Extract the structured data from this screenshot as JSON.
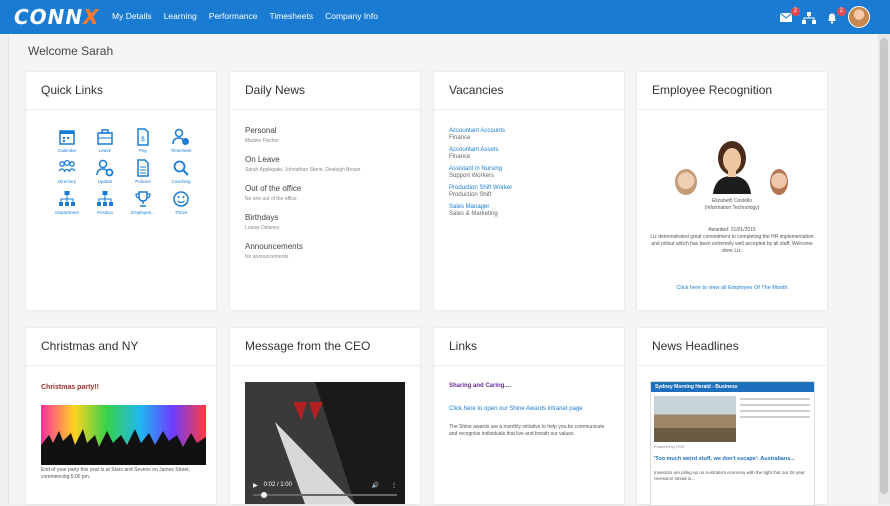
{
  "app": {
    "logo_main": "CONN",
    "logo_x": "X"
  },
  "nav": [
    "My Details",
    "Learning",
    "Performance",
    "Timesheets",
    "Company Info"
  ],
  "header_icons": {
    "notifications": [
      {
        "name": "mail-icon",
        "badge": "2"
      },
      {
        "name": "sitemap-icon",
        "badge": ""
      },
      {
        "name": "bell-icon",
        "badge": "2"
      }
    ]
  },
  "welcome": "Welcome Sarah",
  "cards": {
    "quick_links": {
      "title": "Quick Links",
      "items": [
        {
          "label": "Calendar",
          "icon": "calendar-icon"
        },
        {
          "label": "Leave",
          "icon": "briefcase-icon"
        },
        {
          "label": "Pay",
          "icon": "payslip-icon"
        },
        {
          "label": "Timesheet",
          "icon": "user-clock-icon"
        },
        {
          "label": "Directory",
          "icon": "group-icon"
        },
        {
          "label": "Update",
          "icon": "user-settings-icon"
        },
        {
          "label": "Policies",
          "icon": "document-icon"
        },
        {
          "label": "Coaching",
          "icon": "search-icon"
        },
        {
          "label": "Department",
          "icon": "org-chart-icon"
        },
        {
          "label": "Position",
          "icon": "org-chart-icon"
        },
        {
          "label": "Employee...",
          "icon": "trophy-icon"
        },
        {
          "label": "Thrive",
          "icon": "smiley-icon"
        }
      ]
    },
    "daily_news": {
      "title": "Daily News",
      "sections": [
        {
          "heading": "Personal",
          "body": "Maxine Fischer"
        },
        {
          "heading": "On Leave",
          "body": "Sarah Applegate, Johnathan Stone, Desleigh Brown"
        },
        {
          "heading": "Out of the office",
          "body": "No one out of the office"
        },
        {
          "heading": "Birthdays",
          "body": "Louise Delaney"
        },
        {
          "heading": "Announcements",
          "body": "No announcements"
        }
      ]
    },
    "vacancies": {
      "title": "Vacancies",
      "items": [
        {
          "role": "Accountant Accounts",
          "dept": "Finance"
        },
        {
          "role": "Accountant Assets",
          "dept": "Finance"
        },
        {
          "role": "Assistant in Nursing",
          "dept": "Support Workers"
        },
        {
          "role": "Production Shift Worker",
          "dept": "Production Shift"
        },
        {
          "role": "Sales Manager",
          "dept": "Sales & Marketing"
        }
      ]
    },
    "recognition": {
      "title": "Employee Recognition",
      "name": "Elizabeth Costello",
      "dept": "(Information Technology)",
      "awarded": "Awarded: 21/01/2015",
      "text": "Liz demonstrated great commitment to completing the HR implementation and rollout which has been extremely well accepted by all staff. Welcome done Liz.",
      "link": "Click here to view all Employee Of The Month"
    },
    "christmas": {
      "title": "Christmas and NY",
      "subtitle": "Christmas party!!",
      "text": "End of year party this year is at Stars and Sevens on James Street, commencing 5:00 pm."
    },
    "ceo": {
      "title": "Message from the CEO",
      "time": "0:02 / 1:00"
    },
    "links": {
      "title": "Links",
      "subtitle": "Sharing and Caring....",
      "link": "Click here to open our Shine Awards intranet page",
      "text": "The Shine awards are a monthly initiative to help you be communicate and recognise individuals that live and breath our values."
    },
    "headlines": {
      "title": "News Headlines",
      "paper": "Sydney Morning Herald - Business",
      "powered": "Powered by RSS",
      "headline": "'Too much weird stuff, we don't escape': Australians...",
      "summary": "Investors are piling up on Australia's economy with the tight that our 26 year recession streak is..."
    }
  },
  "colors": {
    "brand": "#1a7bd3",
    "accent": "#ff7a2a",
    "badge": "#e5484d"
  }
}
